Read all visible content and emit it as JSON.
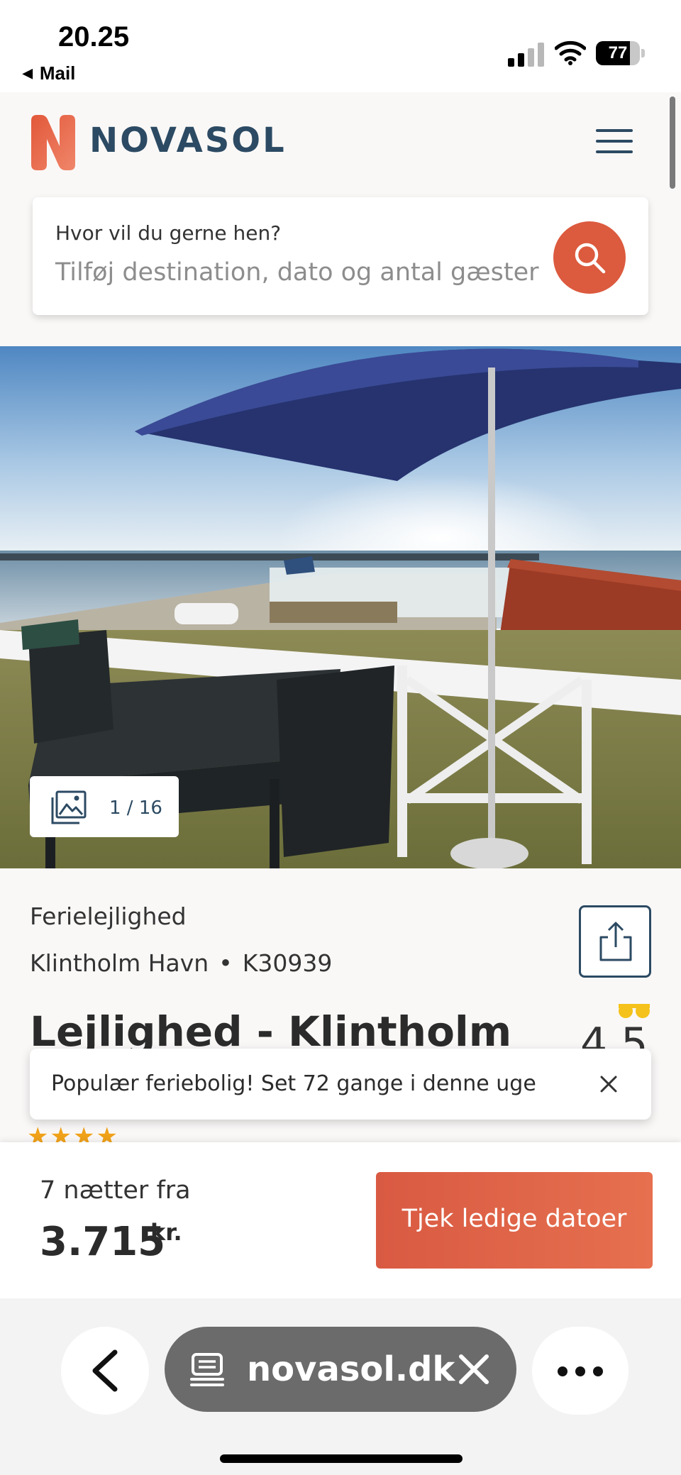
{
  "status_bar": {
    "time": "20.25",
    "back_app": "Mail",
    "battery_percent": 77,
    "battery_label": "77",
    "icons": [
      "cellular-signal-icon",
      "wifi-icon",
      "battery-icon"
    ]
  },
  "header": {
    "logo_text": "NOVASOL",
    "logo_icon": "novasol-n-logo-icon",
    "menu_icon": "hamburger-menu-icon"
  },
  "search": {
    "label": "Hvor vil du gerne hen?",
    "placeholder": "Tilføj destination, dato og antal gæster",
    "button_icon": "search-icon"
  },
  "gallery": {
    "counter": "1 / 16",
    "counter_icon": "gallery-images-icon"
  },
  "property": {
    "type": "Ferielejlighed",
    "location": "Klintholm Havn",
    "code": "K30939",
    "title": "Lejlighed - Klintholm",
    "rating": "4,5",
    "stars": 4,
    "share_icon": "share-icon"
  },
  "toast": {
    "text": "Populær feriebolig! Set 72 gange i denne uge",
    "close_icon": "close-icon"
  },
  "booking": {
    "nights_label": "7 nætter fra",
    "price": "3.715",
    "currency": "kr.",
    "cta_label": "Tjek ledige datoer"
  },
  "browser": {
    "url": "novasol.dk",
    "back_icon": "chevron-left-icon",
    "page_icon": "page-settings-icon",
    "clear_icon": "close-icon",
    "more_icon": "more-dots-icon"
  },
  "colors": {
    "brand_navy": "#2c4a63",
    "brand_orange": "#dc5a3e",
    "star_gold": "#f0a21a"
  }
}
